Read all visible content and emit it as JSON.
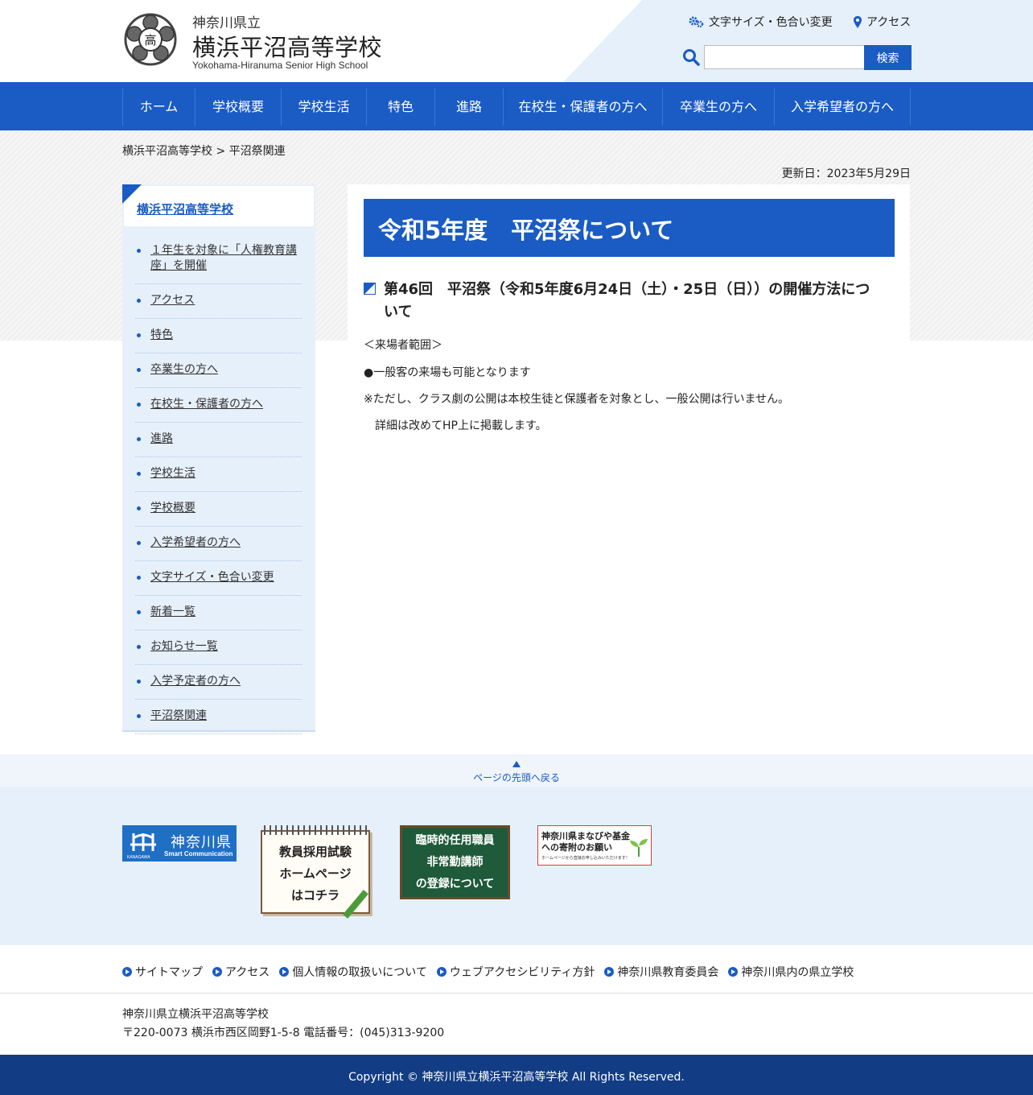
{
  "header": {
    "pref": "神奈川県立",
    "school_name": "横浜平沼高等学校",
    "school_name_en": "Yokohama-Hiranuma Senior High School",
    "util_fontsize": "文字サイズ・色合い変更",
    "util_access": "アクセス",
    "search_placeholder": "",
    "search_button": "検索"
  },
  "nav": [
    {
      "label": "ホーム"
    },
    {
      "label": "学校概要"
    },
    {
      "label": "学校生活"
    },
    {
      "label": "特色"
    },
    {
      "label": "進路"
    },
    {
      "label": "在校生・保護者の方へ"
    },
    {
      "label": "卒業生の方へ"
    },
    {
      "label": "入学希望者の方へ"
    }
  ],
  "breadcrumb": "横浜平沼高等学校 > 平沼祭関連",
  "updated": "更新日：2023年5月29日",
  "sidebar": {
    "title": "横浜平沼高等学校",
    "items": [
      {
        "label": "１年生を対象に「人権教育講座」を開催"
      },
      {
        "label": "アクセス"
      },
      {
        "label": "特色"
      },
      {
        "label": "卒業生の方へ"
      },
      {
        "label": "在校生・保護者の方へ"
      },
      {
        "label": "進路"
      },
      {
        "label": "学校生活"
      },
      {
        "label": "学校概要"
      },
      {
        "label": "入学希望者の方へ"
      },
      {
        "label": "文字サイズ・色合い変更"
      },
      {
        "label": "新着一覧"
      },
      {
        "label": "お知らせ一覧"
      },
      {
        "label": "入学予定者の方へ"
      },
      {
        "label": "平沼祭関連"
      }
    ]
  },
  "main": {
    "title": "令和5年度　平沼祭について",
    "heading": "第46回　平沼祭（令和5年度6月24日（土）・25日（日））の開催方法について",
    "lines": [
      "＜来場者範囲＞",
      "●一般客の来場も可能となります",
      "※ただし、クラス劇の公開は本校生徒と保護者を対象とし、一般公開は行いません。",
      "　詳細は改めてHP上に掲載します。"
    ]
  },
  "pagetop": "ページの先頭へ戻る",
  "banners": {
    "kanagawa": {
      "title": "神奈川県",
      "sub": "Smart Communication",
      "small": "KANAGAWA"
    },
    "recruit": {
      "line1": "教員採用試験",
      "line2": "ホームページ",
      "line3": "はコチラ"
    },
    "board": {
      "line1": "臨時的任用職員",
      "line2": "非常勤講師",
      "line3": "の登録について"
    },
    "manabiya": {
      "line1": "神奈川県まなびや基金への寄附のお願い",
      "line2": "ホームページから直接お申し込みいただけます！"
    }
  },
  "footer_links": [
    {
      "label": "サイトマップ"
    },
    {
      "label": "アクセス"
    },
    {
      "label": "個人情報の取扱いについて"
    },
    {
      "label": "ウェブアクセシビリティ方針"
    },
    {
      "label": "神奈川県教育委員会"
    },
    {
      "label": "神奈川県内の県立学校"
    }
  ],
  "address": {
    "name": "神奈川県立横浜平沼高等学校",
    "detail": "〒220-0073 横浜市西区岡野1-5-8 電話番号：(045)313-9200"
  },
  "copyright": "Copyright © 神奈川県立横浜平沼高等学校 All Rights Reserved.",
  "colors": {
    "primary": "#1a5bc4",
    "light_bg": "#e6f0fb",
    "footer_dark": "#123d84"
  }
}
